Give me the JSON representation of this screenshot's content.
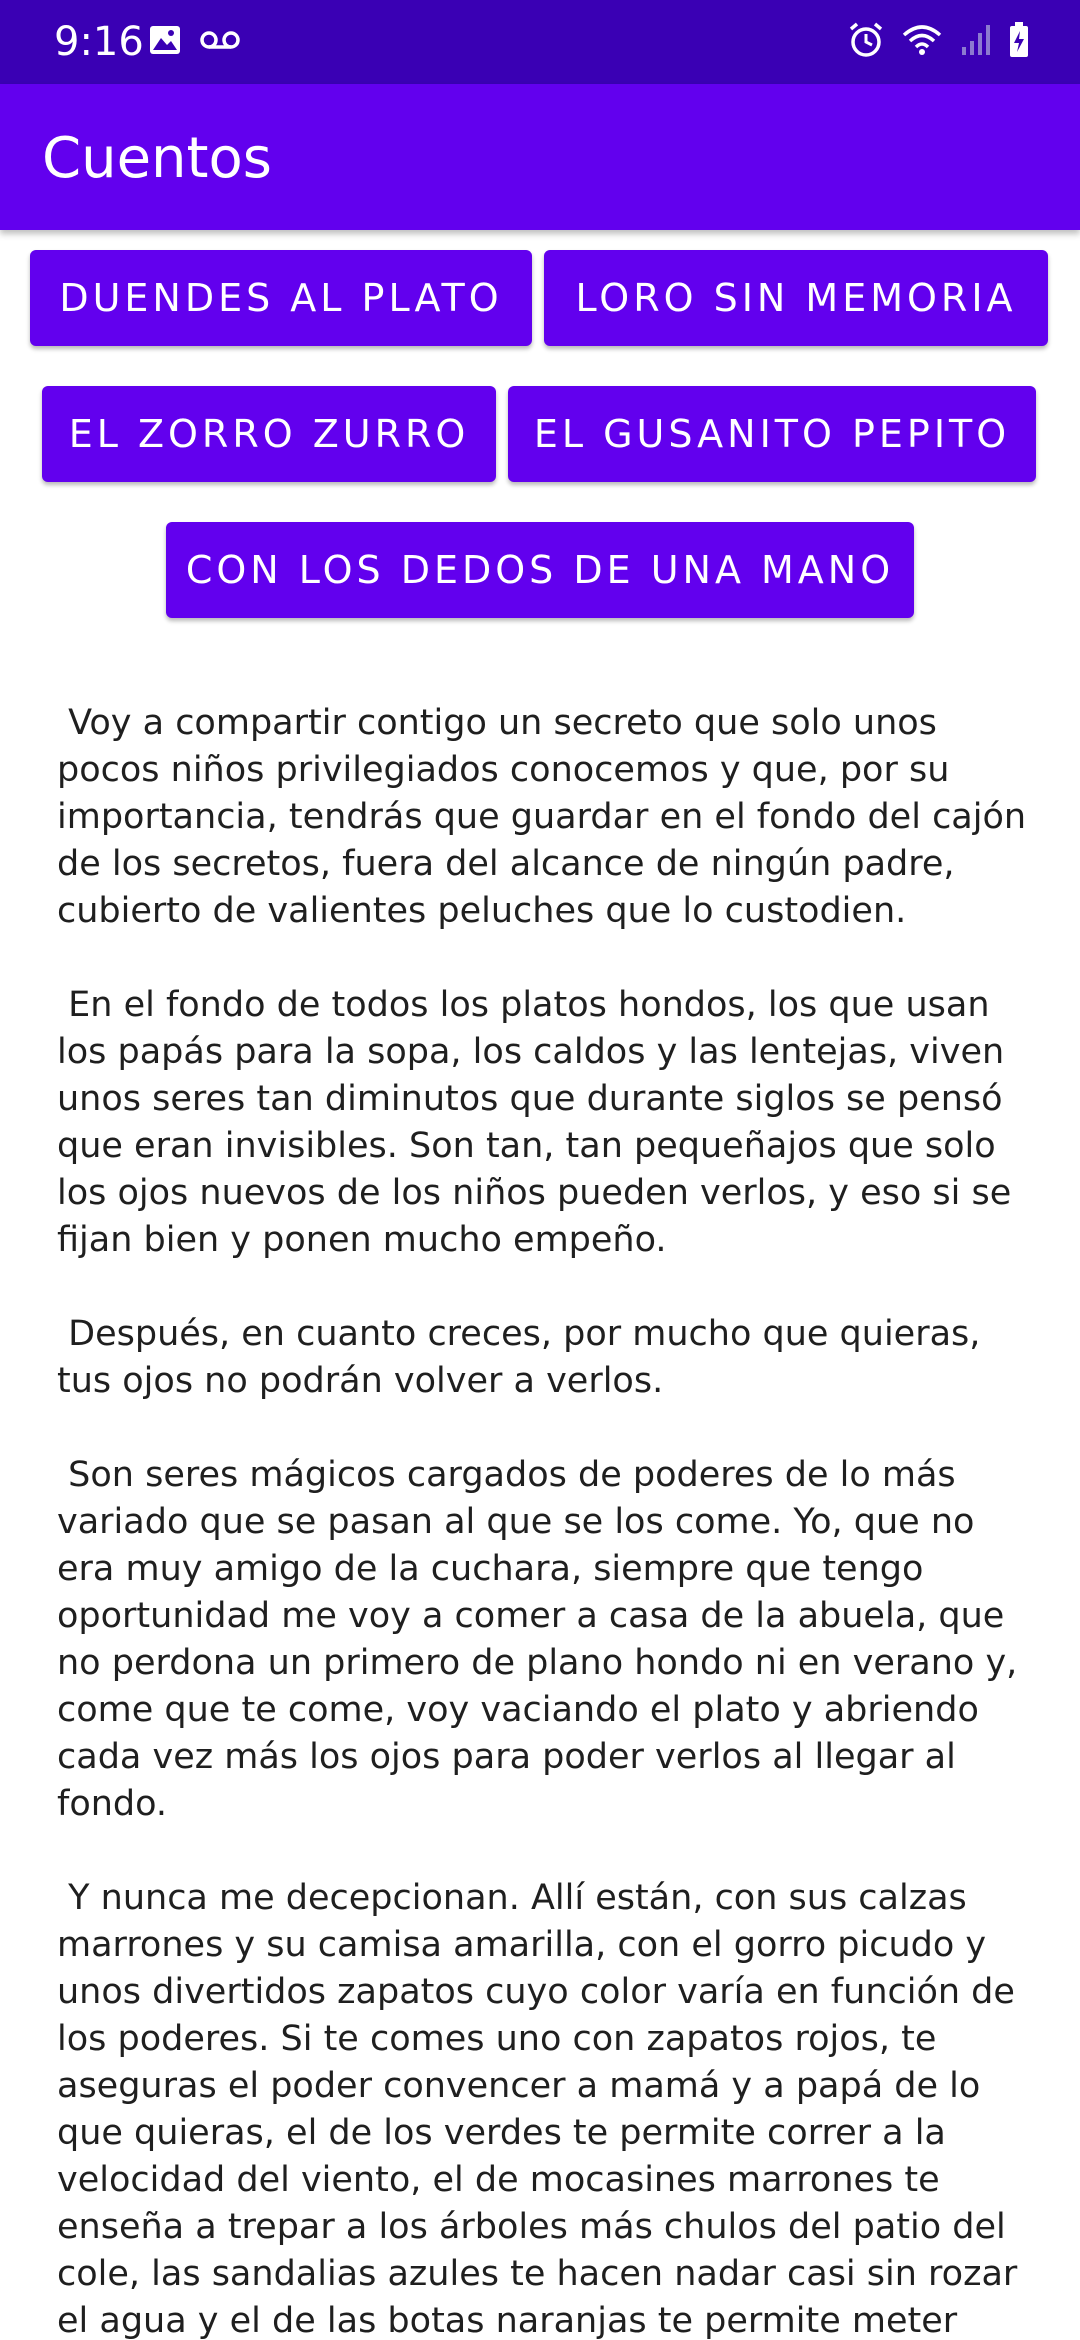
{
  "status_bar": {
    "time": "9:16",
    "left_icons": [
      "image-icon",
      "voicemail-icon"
    ],
    "right_icons": [
      "alarm-icon",
      "wifi-icon",
      "signal-icon",
      "battery-charging-icon"
    ],
    "background_color": "#3a00b4"
  },
  "app_bar": {
    "title": "Cuentos",
    "background_color": "#6200ee"
  },
  "buttons": {
    "duendes": "DUENDES AL PLATO",
    "loro": "LORO SIN MEMORIA",
    "zorro": "EL ZORRO ZURRO",
    "gusanito": "EL GUSANITO PEPITO",
    "dedos": "CON LOS DEDOS DE UNA MANO",
    "color": "#6200ee"
  },
  "story": {
    "paragraphs": [
      " Voy a compartir contigo un secreto que solo unos pocos niños privilegiados conocemos y que, por su importancia, tendrás que guardar en el fondo del cajón de los secretos, fuera del alcance de ningún padre, cubierto de valientes peluches que lo custodien.",
      " En el fondo de todos los platos hondos, los que usan los papás para la sopa, los caldos y las lentejas, viven unos seres tan diminutos que durante siglos se pensó que eran invisibles. Son tan, tan pequeñajos que solo los ojos nuevos de los niños pueden verlos, y eso si se fijan bien y ponen mucho empeño.",
      " Después, en cuanto creces, por mucho que quieras, tus ojos no podrán volver a verlos.",
      " Son seres mágicos cargados de poderes de lo más variado que se pasan al que se los come. Yo, que no era muy amigo de la cuchara, siempre que tengo oportunidad me voy a comer a casa de la abuela, que no perdona un primero de plano hondo ni en verano y, come que te come, voy vaciando el plato y abriendo cada vez más los ojos para poder verlos al llegar al fondo.",
      " Y nunca me decepcionan. Allí están, con sus calzas marrones y su camisa amarilla, con el gorro picudo y unos divertidos zapatos cuyo color varía en función de los poderes. Si te comes uno con zapatos rojos, te aseguras el poder convencer a mamá y a papá de lo que quieras, el de los verdes te permite correr a la velocidad del viento, el de mocasines marrones te enseña a trepar a los árboles más chulos del patio del cole, las sandalias azules te hacen nadar casi sin rozar el agua y el de las botas naranjas te permite meter"
    ]
  }
}
